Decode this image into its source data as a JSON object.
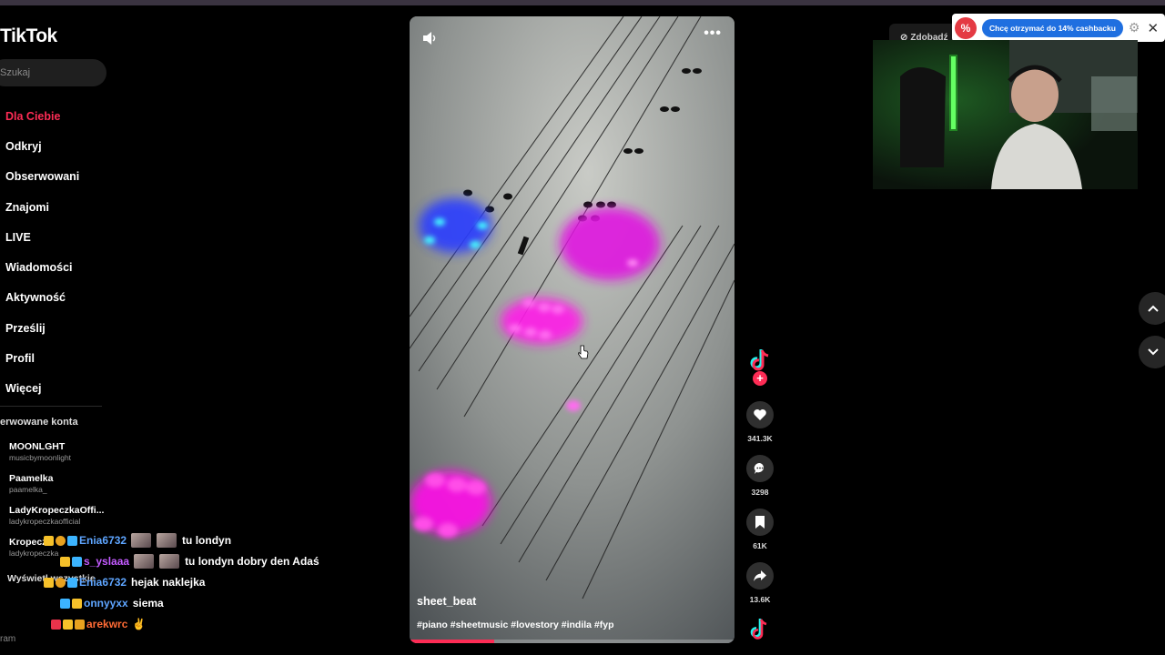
{
  "sidebar": {
    "logo": "TikTok",
    "search_placeholder": "Szukaj",
    "nav": [
      {
        "label": "Dla Ciebie",
        "active": true
      },
      {
        "label": "Odkryj"
      },
      {
        "label": "Obserwowani"
      },
      {
        "label": "Znajomi"
      },
      {
        "label": "LIVE"
      },
      {
        "label": "Wiadomości"
      },
      {
        "label": "Aktywność"
      },
      {
        "label": "Prześlij"
      },
      {
        "label": "Profil"
      },
      {
        "label": "Więcej"
      }
    ],
    "followed_header": "erwowane konta",
    "accounts": [
      {
        "name": "MOONLGHT",
        "handle": "musicbymoonlight"
      },
      {
        "name": "Paamelka",
        "handle": "paamelka_"
      },
      {
        "name": "LadyKropeczkaOffi...",
        "handle": "ladykropeczkaofficial"
      },
      {
        "name": "Kropecz",
        "handle": "ladykropeczka"
      }
    ],
    "see_all": "Wyświetl wszystkie",
    "footer": "ram"
  },
  "video": {
    "author": "sheet_beat",
    "caption": "#piano #sheetmusic #lovestory #indila #fyp",
    "progress": 0.26,
    "more_label": "•••",
    "icons": {
      "mute": "speaker-icon",
      "more": "more-dots-icon"
    }
  },
  "actions": {
    "likes": "341.3K",
    "comments": "3298",
    "saves": "61K",
    "shares": "13.6K"
  },
  "top_right": {
    "get_app_label": "Zdobądź",
    "cashback_text": "Chcę otrzymać do 14% cashbacku",
    "icons": {
      "settings": "gear-icon",
      "close": "close-icon"
    }
  },
  "chat": [
    {
      "user": "Enia6732",
      "color": "#5ea5ff",
      "emotes": 2,
      "msg": "tu londyn"
    },
    {
      "user": "s_yslaaa",
      "color": "#c35bff",
      "emotes": 2,
      "msg": "tu londyn dobry den Adaś"
    },
    {
      "user": "Enia6732",
      "color": "#5ea5ff",
      "emotes": 0,
      "msg": "hejak naklejka"
    },
    {
      "user": "onnyyxx",
      "color": "#5ea5ff",
      "emotes": 0,
      "msg": "siema"
    },
    {
      "user": "arekwrc",
      "color": "#ff6b35",
      "emotes": 0,
      "msg": "✌"
    }
  ],
  "colors": {
    "accent": "#fe2c55",
    "cashback_button": "#1f6fe0"
  }
}
